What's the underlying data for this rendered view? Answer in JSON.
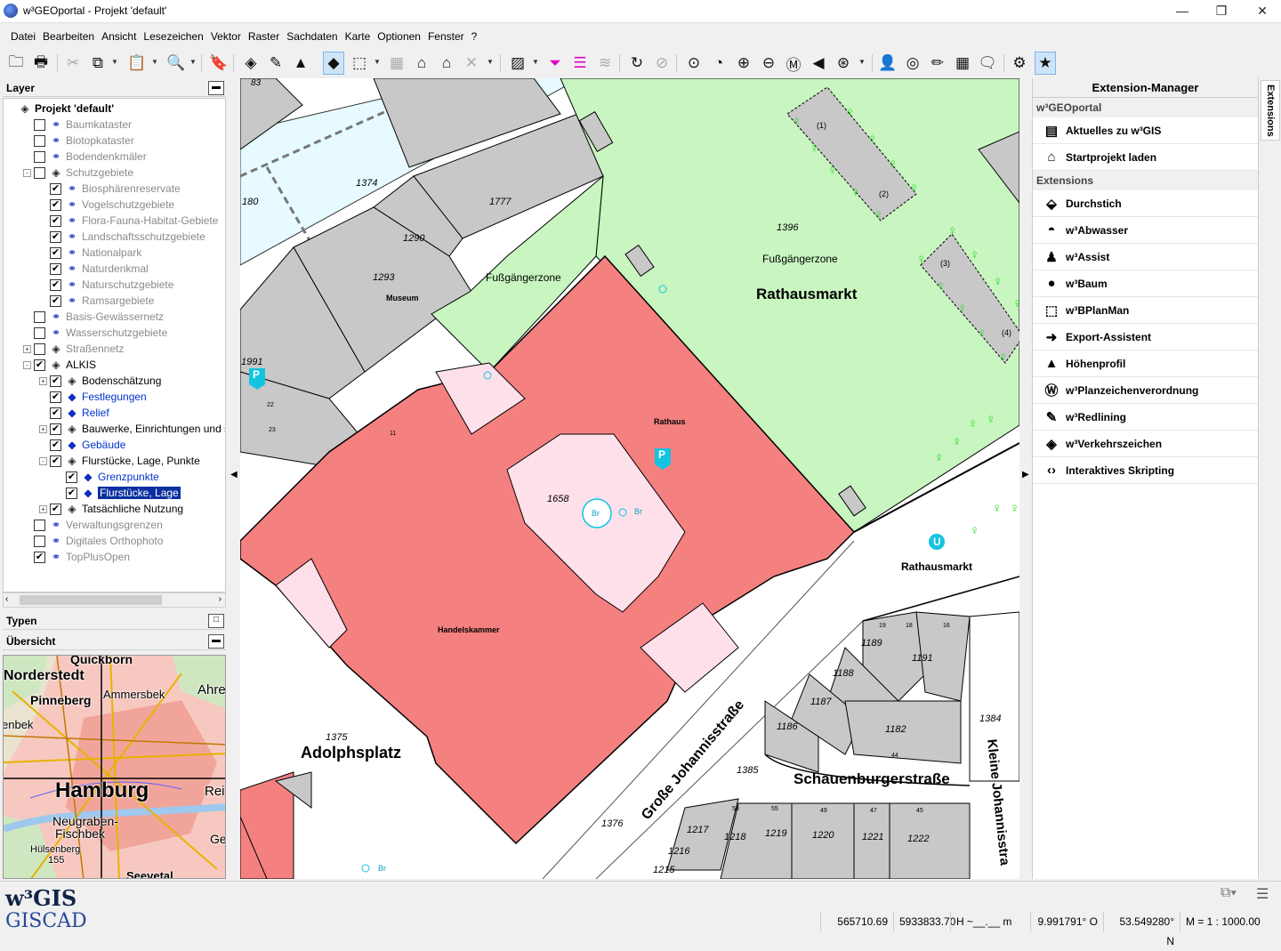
{
  "window": {
    "title": "w³GEOportal - Projekt 'default'",
    "controls": [
      "—",
      "❐",
      "✕"
    ]
  },
  "menu": [
    "Datei",
    "Bearbeiten",
    "Ansicht",
    "Lesezeichen",
    "Vektor",
    "Raster",
    "Sachdaten",
    "Karte",
    "Optionen",
    "Fenster",
    "?"
  ],
  "toolbar_icons": [
    "open-folder",
    "print",
    "cut",
    "copy",
    "paste",
    "zoom",
    "bookmark",
    "layer-stack",
    "edit-line",
    "terrain",
    "select-vertex",
    "select-area",
    "grid",
    "house",
    "houses",
    "cross-out",
    "hatch",
    "filter-magenta",
    "filter-lines",
    "layers-gray",
    "refresh",
    "stop",
    "zoom-fit",
    "zoom-extent",
    "zoom-in",
    "zoom-out",
    "zoom-measure",
    "back",
    "zoom-full",
    "person",
    "target",
    "pencil",
    "table",
    "speech",
    "gear",
    "star"
  ],
  "left": {
    "layer_header": "Layer",
    "typen_header": "Typen",
    "overview_header": "Übersicht",
    "tree": [
      {
        "label": "Projekt 'default'",
        "level": 0,
        "exp": "",
        "cb": false,
        "showcb": false,
        "icon": "stack",
        "style": "bold"
      },
      {
        "label": "Baumkataster",
        "level": 1,
        "exp": "",
        "cb": false,
        "showcb": true,
        "icon": "wms",
        "style": "gray"
      },
      {
        "label": "Biotopkataster",
        "level": 1,
        "exp": "",
        "cb": false,
        "showcb": true,
        "icon": "wms",
        "style": "gray"
      },
      {
        "label": "Bodendenkmäler",
        "level": 1,
        "exp": "",
        "cb": false,
        "showcb": true,
        "icon": "wms",
        "style": "gray"
      },
      {
        "label": "Schutzgebiete",
        "level": 1,
        "exp": "-",
        "cb": false,
        "showcb": true,
        "icon": "stack",
        "style": "gray"
      },
      {
        "label": "Biosphärenreservate",
        "level": 2,
        "exp": "",
        "cb": true,
        "showcb": true,
        "icon": "wms",
        "style": "gray"
      },
      {
        "label": "Vogelschutzgebiete",
        "level": 2,
        "exp": "",
        "cb": true,
        "showcb": true,
        "icon": "wms",
        "style": "gray"
      },
      {
        "label": "Flora-Fauna-Habitat-Gebiete",
        "level": 2,
        "exp": "",
        "cb": true,
        "showcb": true,
        "icon": "wms",
        "style": "gray"
      },
      {
        "label": "Landschaftsschutzgebiete",
        "level": 2,
        "exp": "",
        "cb": true,
        "showcb": true,
        "icon": "wms",
        "style": "gray"
      },
      {
        "label": "Nationalpark",
        "level": 2,
        "exp": "",
        "cb": true,
        "showcb": true,
        "icon": "wms",
        "style": "gray"
      },
      {
        "label": "Naturdenkmal",
        "level": 2,
        "exp": "",
        "cb": true,
        "showcb": true,
        "icon": "wms",
        "style": "gray"
      },
      {
        "label": "Naturschutzgebiete",
        "level": 2,
        "exp": "",
        "cb": true,
        "showcb": true,
        "icon": "wms",
        "style": "gray"
      },
      {
        "label": "Ramsargebiete",
        "level": 2,
        "exp": "",
        "cb": true,
        "showcb": true,
        "icon": "wms",
        "style": "gray"
      },
      {
        "label": "Basis-Gewässernetz",
        "level": 1,
        "exp": "",
        "cb": false,
        "showcb": true,
        "icon": "wms",
        "style": "gray"
      },
      {
        "label": "Wasserschutzgebiete",
        "level": 1,
        "exp": "",
        "cb": false,
        "showcb": true,
        "icon": "wms",
        "style": "gray"
      },
      {
        "label": "Straßennetz",
        "level": 1,
        "exp": "+",
        "cb": false,
        "showcb": true,
        "icon": "stack",
        "style": "gray"
      },
      {
        "label": "ALKIS",
        "level": 1,
        "exp": "-",
        "cb": true,
        "showcb": true,
        "icon": "stack",
        "style": ""
      },
      {
        "label": "Bodenschätzung",
        "level": 2,
        "exp": "+",
        "cb": true,
        "showcb": true,
        "icon": "stack",
        "style": ""
      },
      {
        "label": "Festlegungen",
        "level": 2,
        "exp": "",
        "cb": true,
        "showcb": true,
        "icon": "diamond",
        "style": "blue"
      },
      {
        "label": "Relief",
        "level": 2,
        "exp": "",
        "cb": true,
        "showcb": true,
        "icon": "diamond",
        "style": "blue"
      },
      {
        "label": "Bauwerke, Einrichtungen und sor",
        "level": 2,
        "exp": "+",
        "cb": true,
        "showcb": true,
        "icon": "stack",
        "style": ""
      },
      {
        "label": "Gebäude",
        "level": 2,
        "exp": "",
        "cb": true,
        "showcb": true,
        "icon": "diamond",
        "style": "blue"
      },
      {
        "label": "Flurstücke, Lage, Punkte",
        "level": 2,
        "exp": "-",
        "cb": true,
        "showcb": true,
        "icon": "stack",
        "style": ""
      },
      {
        "label": "Grenzpunkte",
        "level": 3,
        "exp": "",
        "cb": true,
        "showcb": true,
        "icon": "diamond",
        "style": "blue"
      },
      {
        "label": "Flurstücke, Lage",
        "level": 3,
        "exp": "",
        "cb": true,
        "showcb": true,
        "icon": "diamond",
        "style": "sel"
      },
      {
        "label": "Tatsächliche Nutzung",
        "level": 2,
        "exp": "+",
        "cb": true,
        "showcb": true,
        "icon": "stack",
        "style": ""
      },
      {
        "label": "Verwaltungsgrenzen",
        "level": 1,
        "exp": "",
        "cb": false,
        "showcb": true,
        "icon": "wms",
        "style": "gray"
      },
      {
        "label": "Digitales Orthophoto",
        "level": 1,
        "exp": "",
        "cb": false,
        "showcb": true,
        "icon": "wms",
        "style": "gray"
      },
      {
        "label": "TopPlusOpen",
        "level": 1,
        "exp": "",
        "cb": true,
        "showcb": true,
        "icon": "wms",
        "style": "gray"
      }
    ],
    "overview_labels": [
      "Quickborn",
      "Norderstedt",
      "Pinneberg",
      "Ammersbek",
      "Ahre",
      "enbek",
      "Hamburg",
      "Rei",
      "Neugraben-",
      "Fischbek",
      "Ge",
      "Hülsenberg",
      "155",
      "Seevetal"
    ]
  },
  "map": {
    "labels": {
      "p1374": "1374",
      "p180": "180",
      "p1777": "1777",
      "p1290": "1290",
      "p1293": "1293",
      "museum": "Museum",
      "fz1": "Fußgängerzone",
      "fz2": "Fußgängerzone",
      "p1396": "1396",
      "rathausmarkt_big": "Rathausmarkt",
      "p1991": "1991",
      "rathaus": "Rathaus",
      "p1658": "1658",
      "br1": "Br",
      "br2": "Br",
      "br3": "Br",
      "handelskammer": "Handelskammer",
      "p1375": "1375",
      "adolphsplatz": "Adolphsplatz",
      "gr_johann": "Große Johannisstraße",
      "rathausmarkt_small": "Rathausmarkt",
      "p1189": "1189",
      "p1191": "1191",
      "p1188": "1188",
      "p1187": "1187",
      "p1186": "1186",
      "p1182": "1182",
      "p1384": "1384",
      "p1385": "1385",
      "schauenburger": "Schauenburgerstraße",
      "kl_johann": "Kleine Johannisstra",
      "p1376": "1376",
      "p1217": "1217",
      "p1218": "1218",
      "p1219": "1219",
      "p1220": "1220",
      "p1221": "1221",
      "p1222": "1222",
      "p1216": "1216",
      "p1215": "1215",
      "p83": "83",
      "u_station": "U",
      "parking": "P",
      "c1": "(1)",
      "c2": "(2)",
      "c3": "(3)",
      "c4": "(4)",
      "n19": "19",
      "n18": "18",
      "n16": "16",
      "n59": "59",
      "n55": "55",
      "n49": "49",
      "n47": "47",
      "n45": "45",
      "n44": "44",
      "n22": "22",
      "n23": "23",
      "n11": "11"
    }
  },
  "extensions": {
    "title": "Extension-Manager",
    "tab": "Extensions",
    "section1": "w³GEOportal",
    "items1": [
      {
        "icon": "news-icon",
        "glyph": "▤",
        "label": "Aktuelles zu w³GIS"
      },
      {
        "icon": "home-icon",
        "glyph": "⌂",
        "label": "Startprojekt laden"
      }
    ],
    "section2": "Extensions",
    "items2": [
      {
        "icon": "cursor-icon",
        "glyph": "⬙",
        "label": "Durchstich"
      },
      {
        "icon": "sewer-icon",
        "glyph": "◓",
        "label": "w³Abwasser"
      },
      {
        "icon": "person-icon",
        "glyph": "♟",
        "label": "w³Assist"
      },
      {
        "icon": "tree-icon",
        "glyph": "●",
        "label": "w³Baum"
      },
      {
        "icon": "bplan-icon",
        "glyph": "⬚",
        "label": "w³BPlanMan"
      },
      {
        "icon": "export-icon",
        "glyph": "➜",
        "label": "Export-Assistent"
      },
      {
        "icon": "profile-icon",
        "glyph": "▲",
        "label": "Höhenprofil"
      },
      {
        "icon": "plan-icon",
        "glyph": "Ⓦ",
        "label": "w³Planzeichenverordnung"
      },
      {
        "icon": "redlining-icon",
        "glyph": "✎",
        "label": "w³Redlining"
      },
      {
        "icon": "traffic-sign-icon",
        "glyph": "◈",
        "label": "w³Verkehrszeichen"
      },
      {
        "icon": "code-icon",
        "glyph": "‹›",
        "label": "Interaktives Skripting"
      }
    ]
  },
  "status": {
    "logo_top": "w³GIS",
    "logo_bottom": "GISCAD",
    "x": "565710.69",
    "y": "5933833.70",
    "h": "H ~__.__ m",
    "lon": "9.991791° O",
    "lat": "53.549280° N",
    "scale": "M = 1 : 1000.00"
  },
  "colors": {
    "building": "#f48080",
    "plaza": "#c8f5c0",
    "light_red": "#fde0ea",
    "gray_bldg": "#c8c8c8",
    "water": "#e6faff",
    "tree": "#22dd22",
    "selection": "#0a2fa0"
  }
}
